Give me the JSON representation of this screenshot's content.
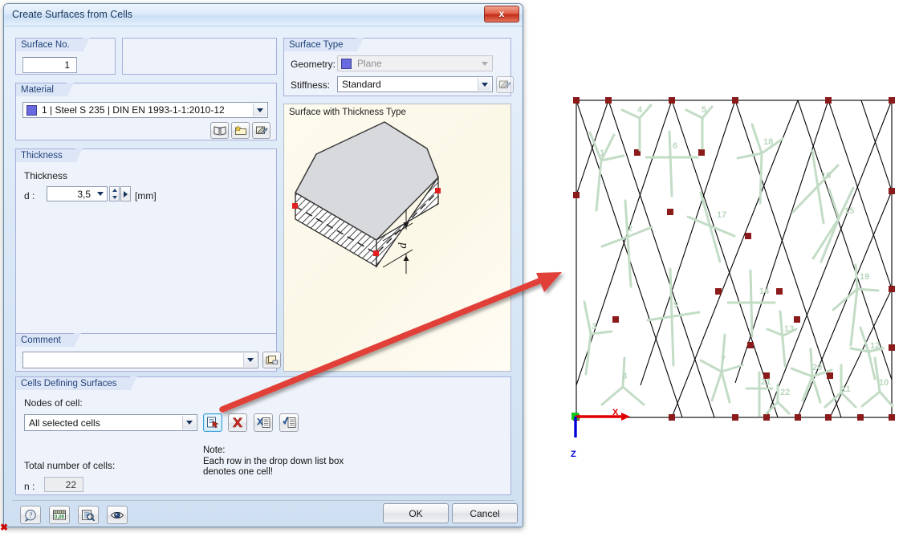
{
  "window": {
    "title": "Create Surfaces from Cells",
    "close_label": "x"
  },
  "surface_no": {
    "caption": "Surface No.",
    "value": "1"
  },
  "surface_type": {
    "caption": "Surface Type",
    "geometry_label": "Geometry:",
    "geometry_value": "Plane",
    "stiffness_label": "Stiffness:",
    "stiffness_value": "Standard"
  },
  "preview": {
    "caption": "Surface with Thickness Type",
    "dim_label": "d"
  },
  "material": {
    "caption": "Material",
    "value": "1  |  Steel S 235  |  DIN EN 1993-1-1:2010-12",
    "color": "#6a6ae0"
  },
  "thickness": {
    "caption": "Thickness",
    "sub_label": "Thickness",
    "d_label": "d :",
    "value": "3,5",
    "unit": "[mm]"
  },
  "comment": {
    "caption": "Comment",
    "value": ""
  },
  "cells": {
    "caption": "Cells Defining Surfaces",
    "nodes_label": "Nodes of cell:",
    "nodes_value": "All selected cells",
    "total_label": "Total number of cells:",
    "n_label": "n :",
    "n_value": "22",
    "note": "Note:\nEach row in the drop down list box\ndenotes one cell!"
  },
  "footer": {
    "ok": "OK",
    "cancel": "Cancel"
  },
  "diagram": {
    "axis_x": "X",
    "axis_z": "Z",
    "node_color": "#8b1a1a",
    "cell_color": "#c3dcc6",
    "cell_labels": [
      "1",
      "2",
      "3",
      "4",
      "5",
      "6",
      "7",
      "8",
      "9",
      "10",
      "11",
      "12",
      "13",
      "14",
      "15",
      "16",
      "17",
      "18",
      "19",
      "20",
      "21",
      "22"
    ]
  }
}
